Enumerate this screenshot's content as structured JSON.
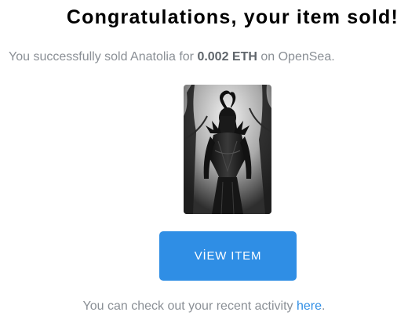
{
  "header": {
    "title": "Congratulations, your item sold!"
  },
  "summary": {
    "prefix": "You successfully sold Anatolia for ",
    "price": "0.002 ETH",
    "suffix": " on OpenSea."
  },
  "item": {
    "image_alt": "Anatolia"
  },
  "actions": {
    "view_item_label": "VİEW ITEM"
  },
  "footer": {
    "prefix": "You can check out your recent activity ",
    "link_label": "here",
    "suffix": "."
  },
  "colors": {
    "accent": "#2f8ee5",
    "muted_text": "#8a8f95",
    "title_text": "#000000"
  }
}
